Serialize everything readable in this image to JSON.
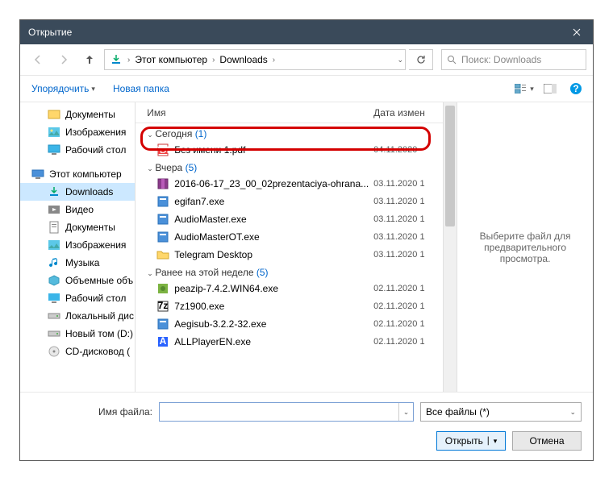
{
  "title": "Открытие",
  "breadcrumb": {
    "root": "Этот компьютер",
    "folder": "Downloads"
  },
  "search": {
    "placeholder": "Поиск: Downloads"
  },
  "toolbar": {
    "organize": "Упорядочить",
    "newfolder": "Новая папка"
  },
  "tree": {
    "docs": "Документы",
    "pics": "Изображения",
    "desktop": "Рабочий стол",
    "pc": "Этот компьютер",
    "downloads": "Downloads",
    "video": "Видео",
    "docs2": "Документы",
    "pics2": "Изображения",
    "music": "Музыка",
    "vol": "Объемные объ",
    "desk2": "Рабочий стол",
    "local": "Локальный дис",
    "newvol": "Новый том (D:)",
    "cd": "CD-дисковод ("
  },
  "headers": {
    "name": "Имя",
    "date": "Дата измен"
  },
  "groups": {
    "today": {
      "label": "Сегодня",
      "count": "(1)"
    },
    "yesterday": {
      "label": "Вчера",
      "count": "(5)"
    },
    "earlier": {
      "label": "Ранее на этой неделе",
      "count": "(5)"
    }
  },
  "files": {
    "today": [
      {
        "name": "Без имени 1.pdf",
        "date": "04.11.2020",
        "icon": "pdf"
      }
    ],
    "yesterday": [
      {
        "name": "2016-06-17_23_00_02prezentaciya-ohrana...",
        "date": "03.11.2020 1",
        "icon": "rar"
      },
      {
        "name": "egifan7.exe",
        "date": "03.11.2020 1",
        "icon": "exe"
      },
      {
        "name": "AudioMaster.exe",
        "date": "03.11.2020 1",
        "icon": "exe"
      },
      {
        "name": "AudioMasterOT.exe",
        "date": "03.11.2020 1",
        "icon": "exe"
      },
      {
        "name": "Telegram Desktop",
        "date": "03.11.2020 1",
        "icon": "folder"
      }
    ],
    "earlier": [
      {
        "name": "peazip-7.4.2.WIN64.exe",
        "date": "02.11.2020 1",
        "icon": "pea"
      },
      {
        "name": "7z1900.exe",
        "date": "02.11.2020 1",
        "icon": "7z"
      },
      {
        "name": "Aegisub-3.2.2-32.exe",
        "date": "02.11.2020 1",
        "icon": "exe"
      },
      {
        "name": "ALLPlayerEN.exe",
        "date": "02.11.2020 1",
        "icon": "all"
      }
    ]
  },
  "preview": "Выберите файл для предварительного просмотра.",
  "filename_label": "Имя файла:",
  "filetype": "Все файлы (*)",
  "open": "Открыть",
  "cancel": "Отмена"
}
